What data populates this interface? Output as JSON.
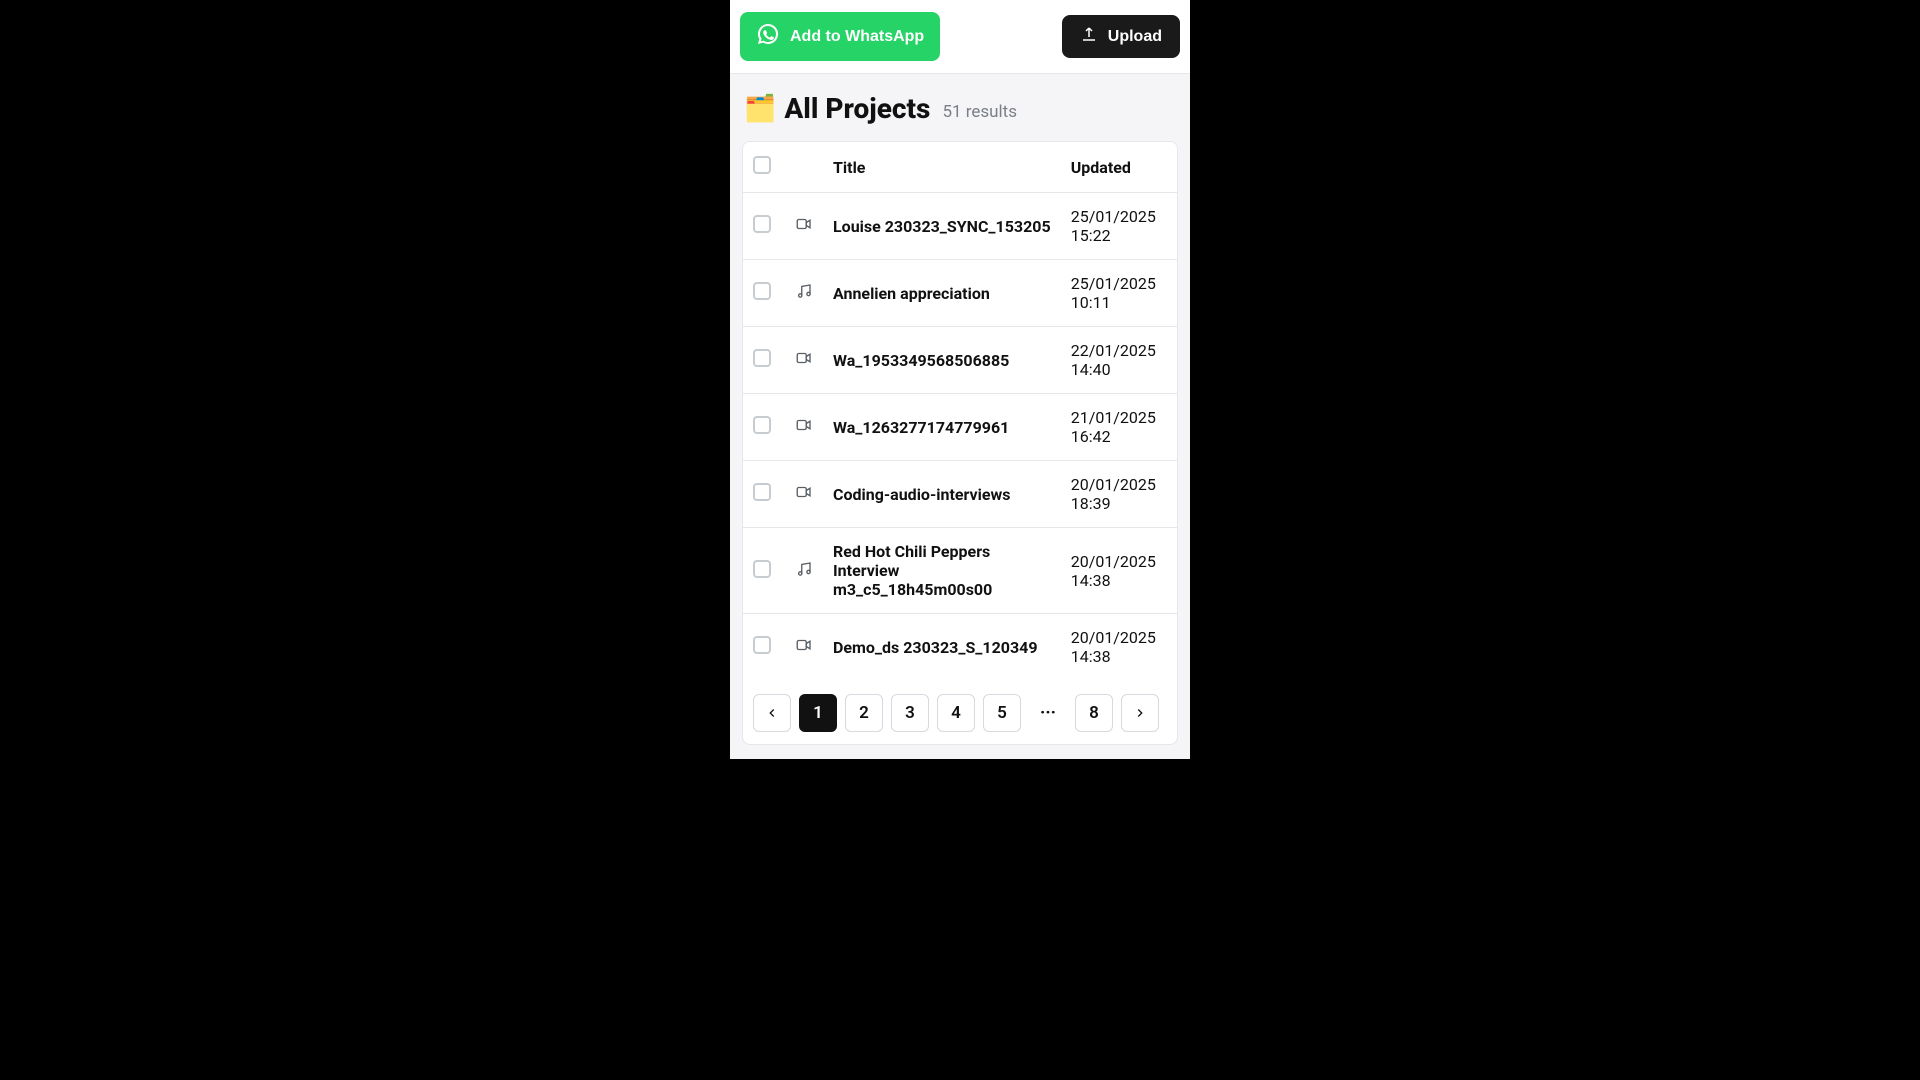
{
  "toolbar": {
    "whatsapp_label": "Add to WhatsApp",
    "upload_label": "Upload"
  },
  "heading": {
    "icon": "🗂️",
    "title": "All Projects",
    "results_text": "51 results"
  },
  "table": {
    "columns": {
      "title": "Title",
      "updated": "Updated"
    },
    "rows": [
      {
        "type": "video",
        "title": "Louise 230323_SYNC_153205",
        "date": "25/01/2025",
        "time": "15:22"
      },
      {
        "type": "audio",
        "title": "Annelien appreciation",
        "date": "25/01/2025",
        "time": "10:11"
      },
      {
        "type": "video",
        "title": "Wa_1953349568506885",
        "date": "22/01/2025",
        "time": "14:40"
      },
      {
        "type": "video",
        "title": "Wa_1263277174779961",
        "date": "21/01/2025",
        "time": "16:42"
      },
      {
        "type": "video",
        "title": "Coding-audio-interviews",
        "date": "20/01/2025",
        "time": "18:39"
      },
      {
        "type": "audio",
        "title": "Red Hot Chili Peppers Interview m3_c5_18h45m00s00",
        "date": "20/01/2025",
        "time": "14:38"
      },
      {
        "type": "video",
        "title": "Demo_ds 230323_S_120349",
        "date": "20/01/2025",
        "time": "14:38"
      }
    ]
  },
  "pagination": {
    "pages": [
      "1",
      "2",
      "3",
      "4",
      "5"
    ],
    "ellipsis": "···",
    "last": "8",
    "active": "1"
  }
}
